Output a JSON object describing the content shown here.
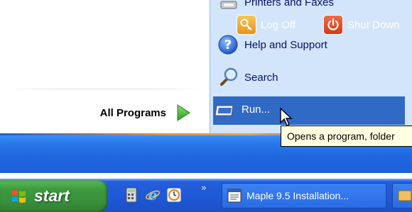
{
  "start_menu": {
    "left": {
      "all_programs": "All Programs"
    },
    "right": {
      "items": [
        {
          "label": "Printers and Faxes",
          "icon": "printer-icon"
        },
        {
          "label": "Help and Support",
          "icon": "help-icon"
        },
        {
          "label": "Search",
          "icon": "search-icon"
        },
        {
          "label": "Run...",
          "icon": "run-icon",
          "highlighted": true
        }
      ]
    },
    "bottom": {
      "log_off": "Log Off",
      "shut_down": "Shut Down"
    }
  },
  "tooltip": {
    "text": "Opens a program, folder"
  },
  "taskbar": {
    "start_label": "start",
    "quick_launch": [
      "calculator-icon",
      "internet-explorer-icon",
      "clock-icon"
    ],
    "chevron": "»",
    "task_button": "Maple 9.5 Installation..."
  },
  "colors": {
    "highlight": "#316ac5",
    "right_panel": "#d3e5fa",
    "taskbar": "#245edb",
    "start_green": "#3c9a3c",
    "tooltip_bg": "#ffffe1"
  }
}
